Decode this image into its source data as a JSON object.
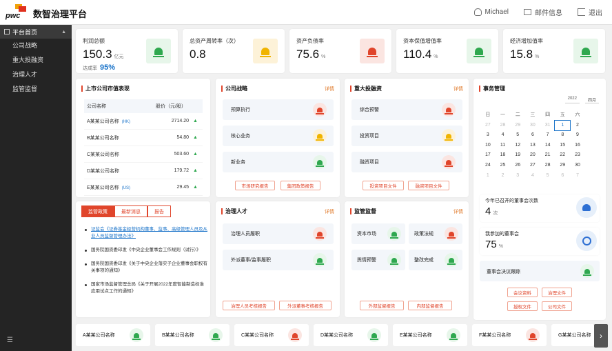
{
  "app": {
    "logo_text": "pwc",
    "title": "数智治理平台"
  },
  "header": {
    "user": "Michael",
    "messages": "邮件信息",
    "logout": "退出"
  },
  "sidebar": {
    "home": "平台首页",
    "items": [
      {
        "label": "公司战略"
      },
      {
        "label": "重大投融资"
      },
      {
        "label": "治理人才"
      },
      {
        "label": "监管监督"
      }
    ]
  },
  "kpis": [
    {
      "label": "利润总额",
      "value": "150.3",
      "unit": "亿元",
      "sub_label": "达成率",
      "sub_value": "95%",
      "status": "green"
    },
    {
      "label": "总资产周转率（次）",
      "value": "0.8",
      "unit": "",
      "status": "yellow"
    },
    {
      "label": "资产负债率",
      "value": "75.6",
      "unit": "%",
      "status": "red"
    },
    {
      "label": "资本保值增值率",
      "value": "110.4",
      "unit": "%",
      "status": "green"
    },
    {
      "label": "经济增加值率",
      "value": "15.8",
      "unit": "%",
      "status": "green"
    }
  ],
  "market": {
    "title": "上市公司市值表现",
    "col_name": "公司名称",
    "col_price": "股价（元/股）",
    "rows": [
      {
        "name": "A某某公司名称",
        "tag": "(HK)",
        "price": "2714.20",
        "trend": "▲"
      },
      {
        "name": "B某某公司名称",
        "tag": "",
        "price": "54.80",
        "trend": "▲"
      },
      {
        "name": "C某某公司名称",
        "tag": "",
        "price": "503.60",
        "trend": "▲"
      },
      {
        "name": "D某某公司名称",
        "tag": "",
        "price": "179.72",
        "trend": "▲"
      },
      {
        "name": "E某某公司名称",
        "tag": "(US)",
        "price": "29.45",
        "trend": "▲"
      }
    ]
  },
  "strategy": {
    "title": "公司战略",
    "more": "详情",
    "items": [
      {
        "label": "预算执行",
        "status": "red"
      },
      {
        "label": "核心业务",
        "status": "yellow"
      },
      {
        "label": "新业务",
        "status": "green"
      }
    ],
    "buttons": [
      "市场研究报告",
      "集团政策报告"
    ]
  },
  "investment": {
    "title": "重大投融资",
    "more": "详情",
    "items": [
      {
        "label": "综合预警",
        "status": "red"
      },
      {
        "label": "投资项目",
        "status": "yellow"
      },
      {
        "label": "融资项目",
        "status": "red"
      }
    ],
    "buttons": [
      "投资项目文件",
      "融资项目文件"
    ]
  },
  "news": {
    "tabs": [
      "监管政策",
      "最新消息",
      "报告"
    ],
    "items": [
      {
        "text": "证监会《证券基金经营机构董事、监事、高级管理人员及从业人员监督管理办法》",
        "link": true
      },
      {
        "text": "国务院国资委印发《中央企业董事会工作规则（试行）》",
        "link": false
      },
      {
        "text": "国务院国资委印发《关于中央企业落实子企业董事会职权有关事项的通知》",
        "link": false
      },
      {
        "text": "国家市场监督管理总局《关于开展2022年度智能制造标准应用试点工作的通知》",
        "link": false
      }
    ]
  },
  "talent": {
    "title": "治理人才",
    "more": "详情",
    "items": [
      {
        "label": "治理人员履职",
        "status": "red"
      },
      {
        "label": "外派董事/监事履职",
        "status": "green"
      }
    ],
    "buttons": [
      "治理人员考核报告",
      "外派董事考核报告"
    ]
  },
  "supervision": {
    "title": "监管监督",
    "more": "详情",
    "items": [
      {
        "label": "资本市场",
        "status": "green"
      },
      {
        "label": "政策法规",
        "status": "red"
      },
      {
        "label": "舆情预警",
        "status": "green"
      },
      {
        "label": "整改完成",
        "status": "green"
      }
    ],
    "buttons": [
      "外部监督报告",
      "内部监督报告"
    ]
  },
  "affairs": {
    "title": "事务管理",
    "year": "2022",
    "month": "四月",
    "weekdays": [
      "日",
      "一",
      "二",
      "三",
      "四",
      "五",
      "六"
    ],
    "weeks": [
      [
        "27",
        "28",
        "29",
        "30",
        "31",
        "1",
        "2"
      ],
      [
        "3",
        "4",
        "5",
        "6",
        "7",
        "8",
        "9"
      ],
      [
        "10",
        "11",
        "12",
        "13",
        "14",
        "15",
        "16"
      ],
      [
        "17",
        "18",
        "19",
        "20",
        "21",
        "22",
        "23"
      ],
      [
        "24",
        "25",
        "26",
        "27",
        "28",
        "29",
        "30"
      ],
      [
        "1",
        "2",
        "3",
        "4",
        "5",
        "6",
        "7"
      ]
    ],
    "today": "1",
    "board_title": "今年已召开的董事会次数",
    "board_value": "4",
    "board_unit": "次",
    "joined_title": "我参加的董事会",
    "joined_value": "75",
    "joined_unit": "%",
    "resolution_title": "董事会决议跟踪",
    "resolution_status": "green",
    "buttons": [
      "会议资料",
      "治理文件",
      "授权文件",
      "公司文件"
    ]
  },
  "companies": [
    {
      "name": "A某某公司名称",
      "status": "green"
    },
    {
      "name": "B某某公司名称",
      "status": "green"
    },
    {
      "name": "C某某公司名称",
      "status": "red"
    },
    {
      "name": "D某某公司名称",
      "status": "green"
    },
    {
      "name": "E某某公司名称",
      "status": "green"
    },
    {
      "name": "F某某公司名称",
      "status": "red"
    },
    {
      "name": "G某某公司名称",
      "status": "green"
    }
  ],
  "colors": {
    "accent": "#e0452b",
    "sidebar": "#242424",
    "link": "#1a73c9",
    "green": "#2fa84f",
    "yellow": "#f0b400",
    "red": "#e0452b"
  },
  "icons": {
    "next": "›"
  }
}
